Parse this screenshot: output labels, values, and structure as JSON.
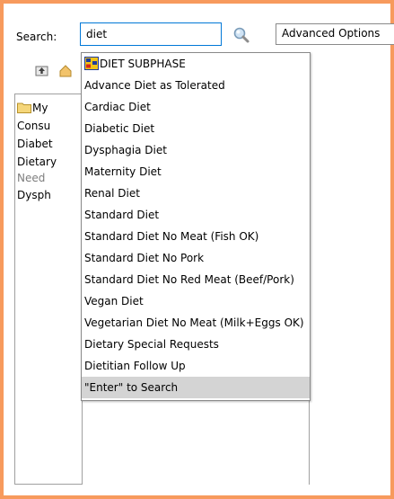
{
  "search": {
    "label": "Search:",
    "value": "diet",
    "button_icon": "magnifier-icon"
  },
  "advanced_options": {
    "label": "Advanced Options"
  },
  "toolbar": {
    "icons": [
      "folder-up-icon",
      "home-icon"
    ]
  },
  "tree": {
    "items": [
      {
        "label": "My",
        "icon": "folder-icon"
      },
      {
        "label": "Consu"
      },
      {
        "label": "Diabet"
      },
      {
        "label": "Dietary"
      },
      {
        "label": "Need",
        "muted": true
      },
      {
        "label": "Dysph"
      }
    ]
  },
  "suggestions": {
    "header": "DIET SUBPHASE",
    "items": [
      "Advance Diet as Tolerated",
      "Cardiac Diet",
      "Diabetic Diet",
      "Dysphagia Diet",
      "Maternity Diet",
      "Renal Diet",
      "Standard Diet",
      "Standard Diet No Meat (Fish OK)",
      "Standard Diet No Pork",
      "Standard Diet No Red Meat (Beef/Pork)",
      "Vegan Diet",
      "Vegetarian Diet No Meat (Milk+Eggs OK)",
      "Dietary Special Requests",
      "Dietitian Follow Up"
    ],
    "enter_hint": "\"Enter\" to Search"
  },
  "colors": {
    "frame_border": "#f79a5d",
    "input_focus_border": "#0078d7",
    "highlight_row": "#d4d4d4"
  }
}
